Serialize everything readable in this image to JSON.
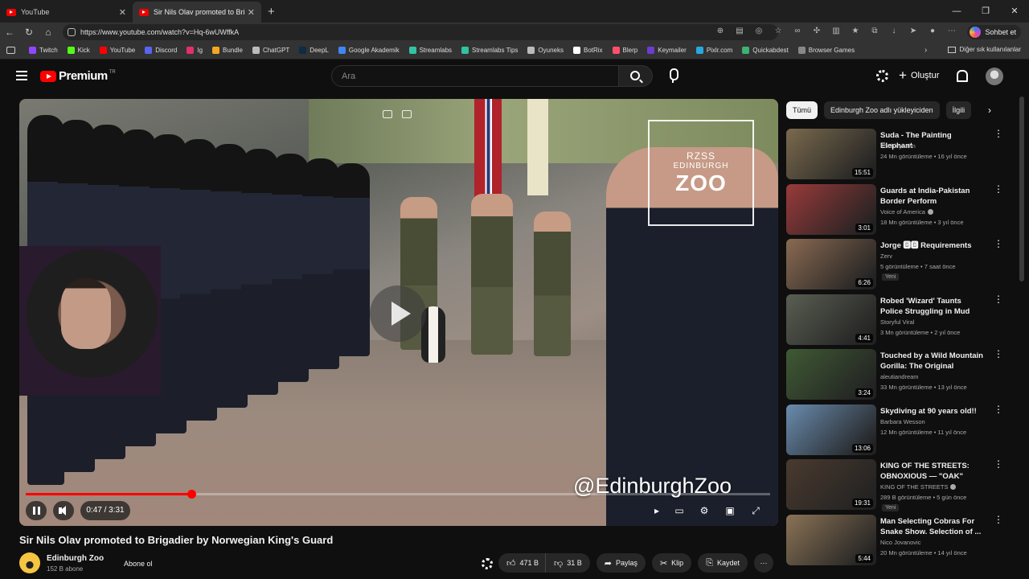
{
  "browser": {
    "tabs": [
      {
        "title": "YouTube"
      },
      {
        "title": "Sir Nils Olav promoted to Brigadier"
      }
    ],
    "url": "https://www.youtube.com/watch?v=Hq-6wUWffkA",
    "copilot_label": "Sohbet et",
    "bookmarks": [
      {
        "label": "Twitch",
        "color": "#9146ff"
      },
      {
        "label": "Kick",
        "color": "#53fc18"
      },
      {
        "label": "YouTube",
        "color": "#ff0000"
      },
      {
        "label": "Discord",
        "color": "#5865f2"
      },
      {
        "label": "Ig",
        "color": "#e1306c"
      },
      {
        "label": "Bundle",
        "color": "#f5a623"
      },
      {
        "label": "ChatGPT",
        "color": "#bbbbbb"
      },
      {
        "label": "DeepL",
        "color": "#0f2b46"
      },
      {
        "label": "Google Akademik",
        "color": "#4285f4"
      },
      {
        "label": "Streamlabs",
        "color": "#31c3a2"
      },
      {
        "label": "Streamlabs Tips",
        "color": "#31c3a2"
      },
      {
        "label": "Oyuneks",
        "color": "#bbbbbb"
      },
      {
        "label": "BotRix",
        "color": "#ffffff"
      },
      {
        "label": "Blerp",
        "color": "#ff4f6d"
      },
      {
        "label": "Keymailer",
        "color": "#6e3ccf"
      },
      {
        "label": "Pixlr.com",
        "color": "#2aa7e0"
      },
      {
        "label": "Quickabdest",
        "color": "#3cb371"
      },
      {
        "label": "Browser Games",
        "color": "#888888"
      }
    ],
    "bookmarks_other": "Diğer sık kullanılanlar"
  },
  "header": {
    "logo_word": "Premium",
    "region": "TR",
    "search_placeholder": "Ara",
    "create_label": "Oluştur"
  },
  "player": {
    "current_time": "0:47",
    "duration": "3:31",
    "progress_fraction": 0.2227,
    "time_display": "0:47 / 3:31",
    "watermark": "@EdinburghZoo",
    "zoo_logo": {
      "line1": "RZSS",
      "line2": "EDINBURGH",
      "line3": "ZOO"
    }
  },
  "video": {
    "title": "Sir Nils Olav promoted to Brigadier by Norwegian King's Guard",
    "channel": "Edinburgh Zoo",
    "subscribers": "152 B abone",
    "subscribe_label": "Abone ol",
    "likes": "471 B",
    "dislikes": "31 B",
    "share_label": "Paylaş",
    "clip_label": "Klip",
    "save_label": "Kaydet"
  },
  "chips": [
    {
      "label": "Tümü",
      "active": true
    },
    {
      "label": "Edinburgh Zoo adlı yükleyiciden",
      "active": false
    },
    {
      "label": "İlgili",
      "active": false
    }
  ],
  "recommendations": [
    {
      "title": "Suda - The Painting Elephant",
      "channel": "FSchleyhahn",
      "meta": "24 Mn görüntüleme • 16 yıl önce",
      "duration": "15:51",
      "verified": false,
      "badge": "",
      "color": "#7a6a4e"
    },
    {
      "title": "Guards at India-Pakistan Border Perform Independence Day ...",
      "channel": "Voice of America",
      "meta": "18 Mn görüntüleme • 3 yıl önce",
      "duration": "3:01",
      "verified": true,
      "badge": "",
      "color": "#9a3a3a"
    },
    {
      "title": "Jorge 🅱🅱 Requirements",
      "channel": "Zerv",
      "meta": "5 görüntüleme • 7 saat önce",
      "duration": "6:26",
      "verified": false,
      "badge": "Yeni",
      "color": "#8a6a52"
    },
    {
      "title": "Robed 'Wizard' Taunts Police Struggling in Mud",
      "channel": "Storyful Viral",
      "meta": "3 Mn görüntüleme • 2 yıl önce",
      "duration": "4:41",
      "verified": false,
      "badge": "",
      "color": "#5a5e52"
    },
    {
      "title": "Touched by a Wild Mountain Gorilla: The Original",
      "channel": "aleutiandream",
      "meta": "33 Mn görüntüleme • 13 yıl önce",
      "duration": "3:24",
      "verified": false,
      "badge": "",
      "color": "#3f5a34"
    },
    {
      "title": "Skydiving at 90 years old!!",
      "channel": "Barbara Wesson",
      "meta": "12 Mn görüntüleme • 11 yıl önce",
      "duration": "13:06",
      "verified": false,
      "badge": "",
      "color": "#6a8cae"
    },
    {
      "title": "KING OF THE STREETS: OBNOXIOUS — \"OAK\" [H.F.A ...",
      "channel": "KING OF THE STREETS",
      "meta": "289 B görüntüleme • 5 gün önce",
      "duration": "19:31",
      "verified": true,
      "badge": "Yeni",
      "color": "#4a3a2e"
    },
    {
      "title": "Man Selecting Cobras For Snake Show. Selection of ...",
      "channel": "Nico Jovanovic",
      "meta": "20 Mn görüntüleme • 14 yıl önce",
      "duration": "5:44",
      "verified": false,
      "badge": "",
      "color": "#8a7356"
    }
  ]
}
